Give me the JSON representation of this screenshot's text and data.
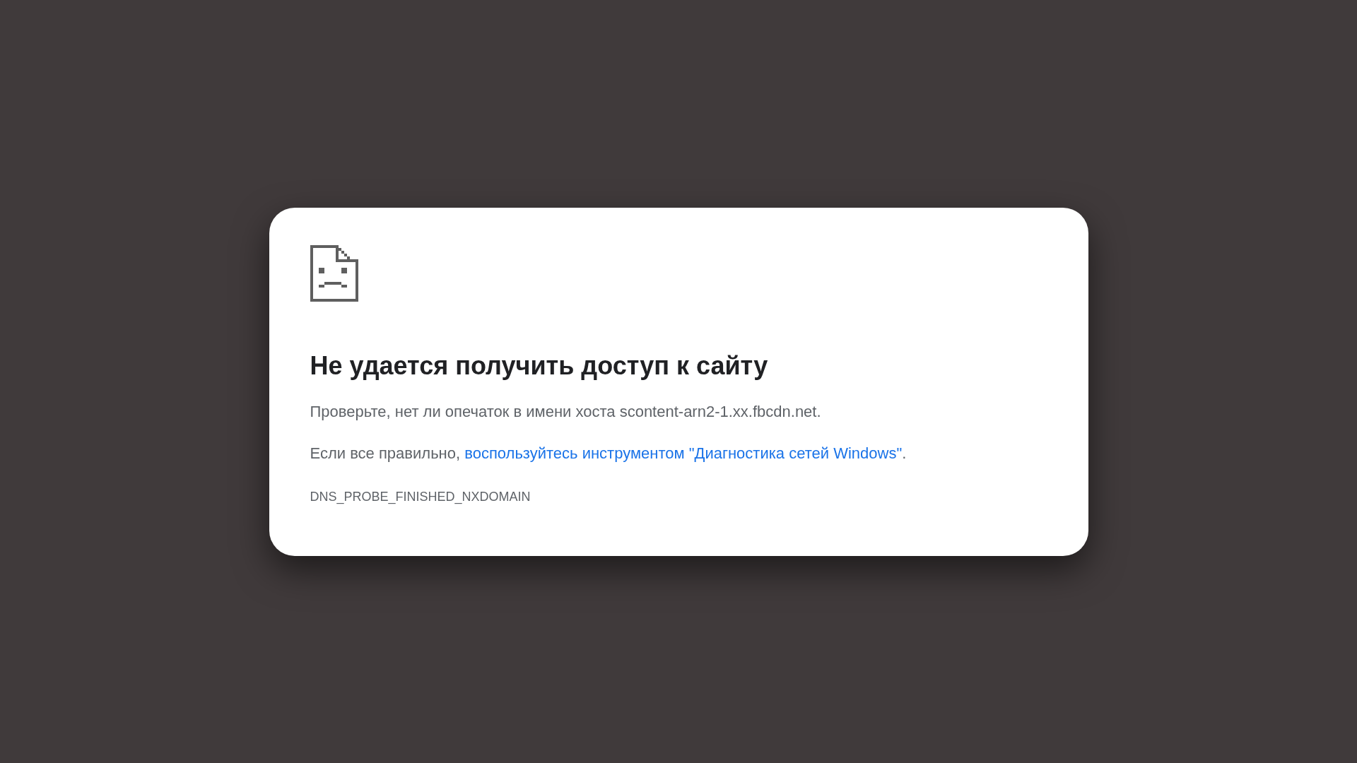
{
  "error_page": {
    "title": "Не удается получить доступ к сайту",
    "hint": "Проверьте, нет ли опечаток в имени хоста scontent-arn2-1.xx.fbcdn.net.",
    "suggestion": {
      "prefix": "Если все правильно, ",
      "link": "воспользуйтесь инструментом \"Диагностика сетей Windows\"",
      "suffix": "."
    },
    "error_code": "DNS_PROBE_FINISHED_NXDOMAIN"
  }
}
